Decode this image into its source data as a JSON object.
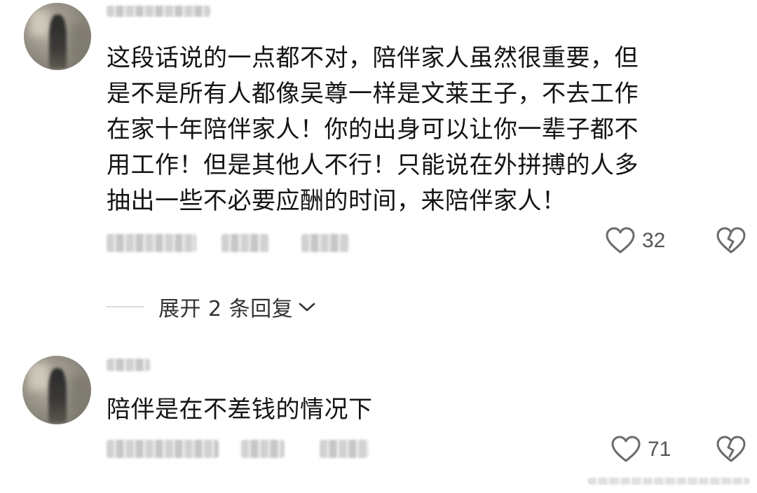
{
  "comments": [
    {
      "text_lines": [
        "这段话说的一点都不对，陪伴家人虽然很重要，但",
        "是不是所有人都像吴尊一样是文莱王子，不去工作",
        "在家十年陪伴家人！你的出身可以让你一辈子都不",
        "用工作！但是其他人不行！只能说在外拼搏的人多",
        "抽出一些不必要应酬的时间，来陪伴家人！"
      ],
      "like_count": "32",
      "expand_replies_label": "展开 2 条回复"
    },
    {
      "text_lines": [
        "陪伴是在不差钱的情况下"
      ],
      "like_count": "71"
    }
  ],
  "icons": {
    "like": "heart-outline-icon",
    "dislike": "broken-heart-icon",
    "expand": "chevron-down-icon"
  },
  "colors": {
    "text": "#141414",
    "meta": "#555555",
    "divider": "#dcdcdc"
  }
}
